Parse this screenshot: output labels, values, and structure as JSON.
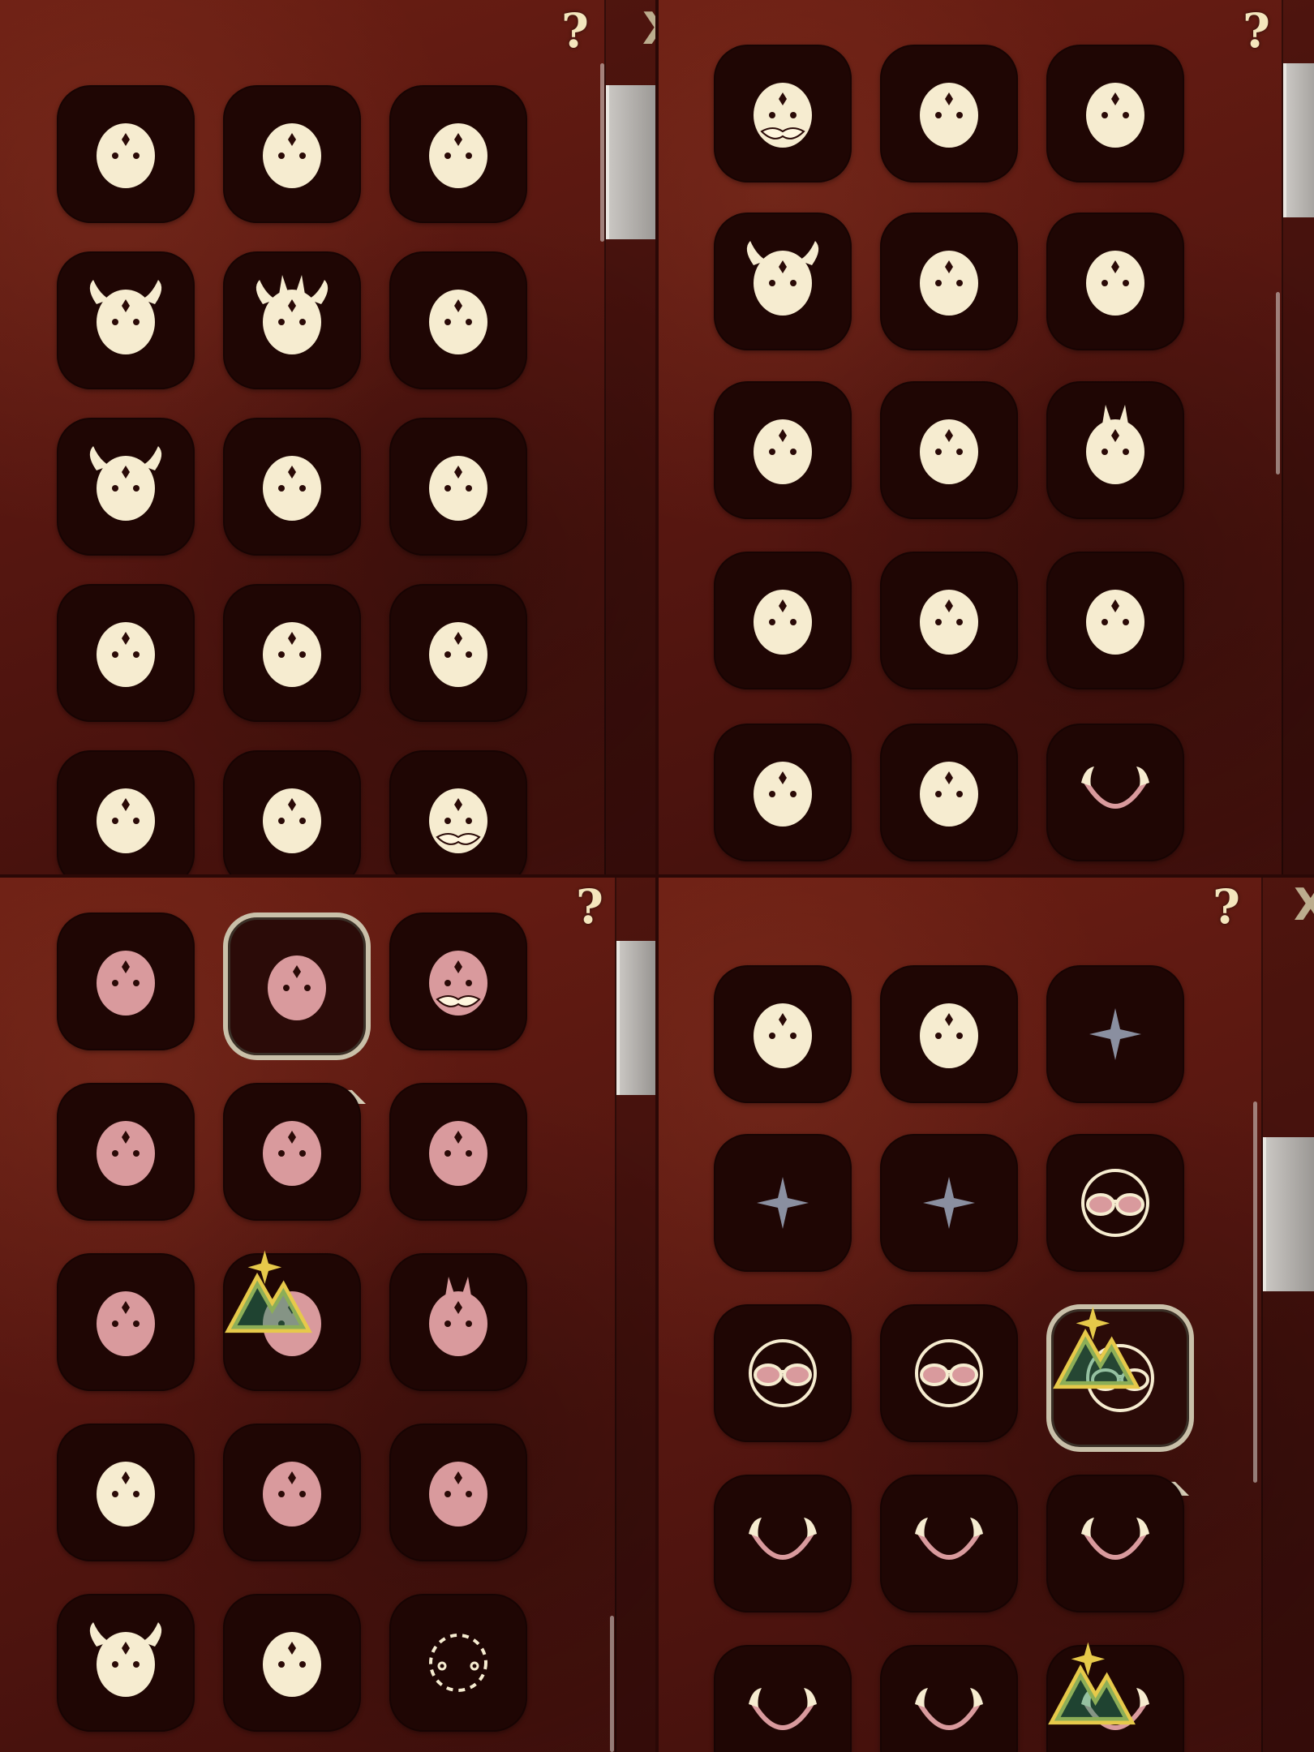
{
  "header": {
    "help_label": "?",
    "close_label": "X"
  },
  "colors": {
    "cream": "#f6ecd0",
    "pink": "#d99a9d",
    "tile": "#1f0604",
    "accent_green": "#1f8f69",
    "accent_gold": "#e6c94a"
  },
  "quadrants": [
    {
      "id": "q1",
      "tiles": [
        {
          "icon": "round-mask-diamond-icon"
        },
        {
          "icon": "sleeping-mask-sparkle-icon"
        },
        {
          "icon": "bandit-mask-icon"
        },
        {
          "icon": "horned-robot-mask-icon"
        },
        {
          "icon": "fox-mask-icon"
        },
        {
          "icon": "unicorn-fang-mask-icon"
        },
        {
          "icon": "ox-horn-fanged-mask-icon"
        },
        {
          "icon": "wolf-mask-icon"
        },
        {
          "icon": "blush-mask-icon"
        },
        {
          "icon": "blush-mask-alt-icon"
        },
        {
          "icon": "tear-mask-icon"
        },
        {
          "icon": "dot-cheek-mask-icon"
        },
        {
          "icon": "v-mark-mask-icon"
        },
        {
          "icon": "diamond-dots-mask-icon"
        },
        {
          "icon": "mustache-mask-icon"
        }
      ]
    },
    {
      "id": "q2",
      "tiles": [
        {
          "icon": "old-beard-mask-icon"
        },
        {
          "icon": "scarf-mask-icon"
        },
        {
          "icon": "moth-mask-icon"
        },
        {
          "icon": "ox-skull-mask-icon"
        },
        {
          "icon": "crab-knight-mask-icon"
        },
        {
          "icon": "aztec-mask-icon"
        },
        {
          "icon": "lion-dog-mask-icon"
        },
        {
          "icon": "crescent-bird-mask-icon"
        },
        {
          "icon": "rabbit-mask-icon"
        },
        {
          "icon": "pigeon-mask-icon"
        },
        {
          "icon": "owl-mask-icon"
        },
        {
          "icon": "feather-crest-mask-icon"
        },
        {
          "icon": "fleur-mask-icon"
        },
        {
          "icon": "eyepatch-mask-icon"
        },
        {
          "icon": "antenna-headband-mask-icon"
        }
      ]
    },
    {
      "id": "q3",
      "tiles": [
        {
          "icon": "sleepy-pink-mask-icon"
        },
        {
          "icon": "star-eyes-pink-mask-icon",
          "selected": true
        },
        {
          "icon": "mustache-pink-mask-icon"
        },
        {
          "icon": "flame-pink-mask-icon"
        },
        {
          "icon": "crab-pink-mask-icon"
        },
        {
          "icon": "antler-pink-mask-icon"
        },
        {
          "icon": "warrior-pink-mask-icon"
        },
        {
          "icon": "blindfold-pink-mask-icon",
          "badge": true
        },
        {
          "icon": "rabbit-pink-mask-icon"
        },
        {
          "icon": "crowned-cat-mask-icon"
        },
        {
          "icon": "blush-cheeks-mask-icon"
        },
        {
          "icon": "rose-mask-icon"
        },
        {
          "icon": "bull-horns-icon"
        },
        {
          "icon": "tiger-mask-icon"
        },
        {
          "icon": "empty-dashed-slot-icon"
        }
      ]
    },
    {
      "id": "q4",
      "tiles": [
        {
          "icon": "crowned-cat-mask-icon"
        },
        {
          "icon": "shield-crest-mask-icon"
        },
        {
          "icon": "empty-sparkle-icon"
        },
        {
          "icon": "empty-sparkle-icon"
        },
        {
          "icon": "empty-sparkle-icon"
        },
        {
          "icon": "round-sunglasses-icon"
        },
        {
          "icon": "eye-mask-goggles-icon"
        },
        {
          "icon": "pink-glasses-icon"
        },
        {
          "icon": "white-glasses-icon",
          "selected": true,
          "badge": true
        },
        {
          "icon": "horned-headband-icon"
        },
        {
          "icon": "beaded-headband-icon"
        },
        {
          "icon": "moon-star-headband-icon"
        },
        {
          "icon": "tusk-necklace-icon"
        },
        {
          "icon": "ribbon-necklace-icon"
        },
        {
          "icon": "vine-necklace-icon",
          "badge": true
        }
      ]
    }
  ]
}
